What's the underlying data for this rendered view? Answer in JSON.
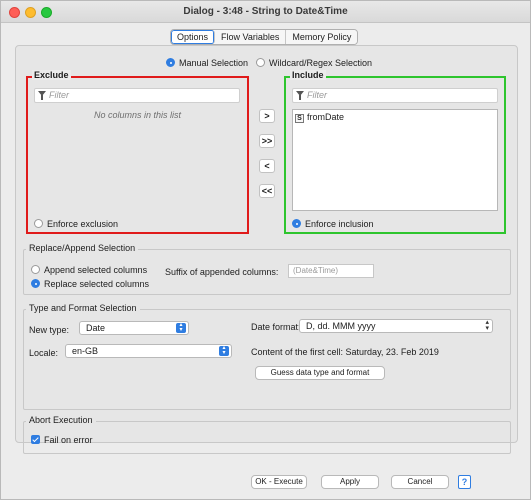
{
  "window": {
    "title": "Dialog - 3:48 - String to Date&Time"
  },
  "tabs": [
    "Options",
    "Flow Variables",
    "Memory Policy"
  ],
  "selection_mode": {
    "manual": "Manual Selection",
    "wildcard": "Wildcard/Regex Selection"
  },
  "exclude": {
    "title": "Exclude",
    "filter_placeholder": "Filter",
    "empty_text": "No columns in this list",
    "enforce": "Enforce exclusion",
    "border_color": "#e01b1b"
  },
  "include": {
    "title": "Include",
    "filter_placeholder": "Filter",
    "items": [
      {
        "type": "S",
        "name": "fromDate"
      }
    ],
    "enforce": "Enforce inclusion",
    "border_color": "#2ec52e"
  },
  "move_buttons": {
    "add": ">",
    "add_all": ">>",
    "remove": "<",
    "remove_all": "<<"
  },
  "replace_append": {
    "title": "Replace/Append Selection",
    "append": "Append selected columns",
    "replace": "Replace selected columns",
    "suffix_label": "Suffix of appended columns:",
    "suffix_placeholder": "(Date&Time)"
  },
  "type_format": {
    "title": "Type and Format Selection",
    "new_type_label": "New type:",
    "new_type_value": "Date",
    "locale_label": "Locale:",
    "locale_value": "en-GB",
    "date_format_label": "Date format:",
    "date_format_value": "D, dd. MMM yyyy",
    "first_cell": "Content of the first cell: Saturday, 23. Feb 2019",
    "guess_button": "Guess data type and format"
  },
  "abort": {
    "title": "Abort Execution",
    "fail_on_error": "Fail on error"
  },
  "footer": {
    "ok_execute": "OK - Execute",
    "apply": "Apply",
    "cancel": "Cancel",
    "help": "?"
  }
}
